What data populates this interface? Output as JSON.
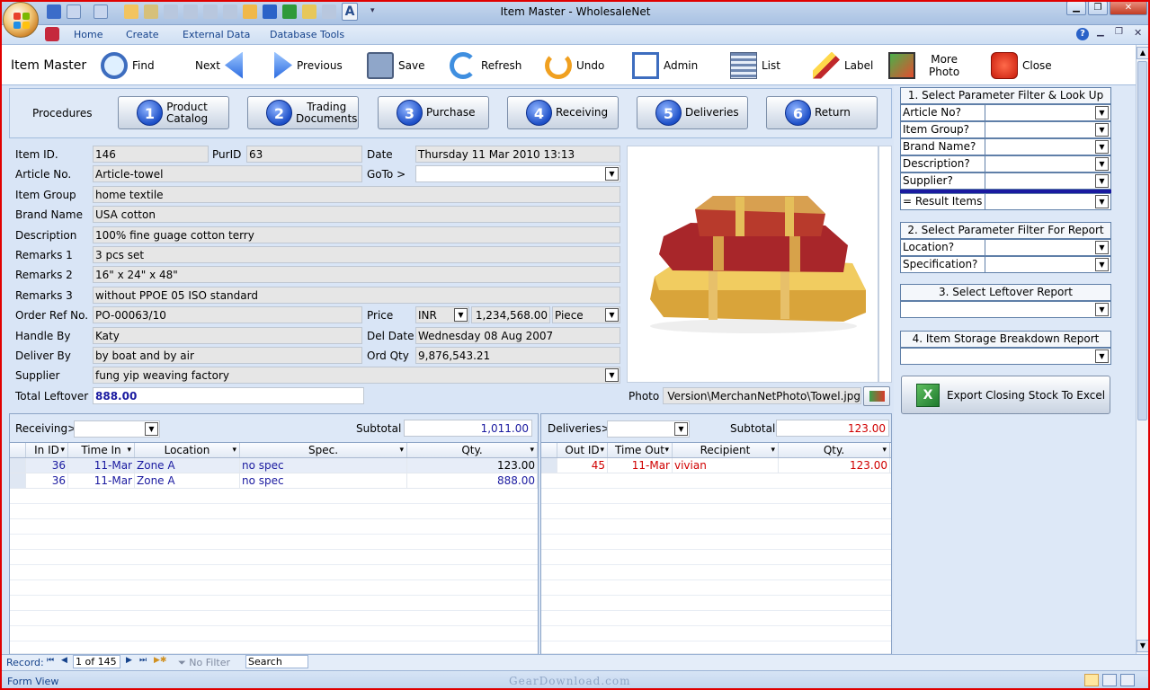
{
  "window": {
    "title": "Item Master - WholesaleNet"
  },
  "menu": {
    "items": [
      "Home",
      "Create",
      "External Data",
      "Database Tools"
    ]
  },
  "toolbar": {
    "form_title": "Item Master",
    "find": "Find",
    "next": "Next",
    "previous": "Previous",
    "save": "Save",
    "refresh": "Refresh",
    "undo": "Undo",
    "admin": "Admin",
    "list": "List",
    "label": "Label",
    "more_photo_1": "More",
    "more_photo_2": "Photo",
    "close": "Close"
  },
  "procedures": {
    "label": "Procedures",
    "buttons": [
      {
        "num": "1",
        "line1": "Product",
        "line2": "Catalog"
      },
      {
        "num": "2",
        "line1": "Trading",
        "line2": "Documents"
      },
      {
        "num": "3",
        "line1": "Purchase",
        "line2": ""
      },
      {
        "num": "4",
        "line1": "Receiving",
        "line2": ""
      },
      {
        "num": "5",
        "line1": "Deliveries",
        "line2": ""
      },
      {
        "num": "6",
        "line1": "Return",
        "line2": ""
      }
    ]
  },
  "item": {
    "item_id_label": "Item ID.",
    "item_id": "146",
    "purid_label": "PurID",
    "purid": "63",
    "date_label": "Date",
    "date": "Thursday 11 Mar 2010 13:13",
    "article_label": "Article No.",
    "article": "Article-towel",
    "goto_label": "GoTo >",
    "goto": "",
    "group_label": "Item Group",
    "group": "home textile",
    "brand_label": "Brand Name",
    "brand": "USA cotton",
    "desc_label": "Description",
    "desc": "100% fine guage cotton terry",
    "rem1_label": "Remarks 1",
    "rem1": "3 pcs set",
    "rem2_label": "Remarks 2",
    "rem2": "16\" x 24\" x 48\"",
    "rem3_label": "Remarks 3",
    "rem3": "without PPOE 05 ISO standard",
    "order_label": "Order Ref No.",
    "order": "PO-00063/10",
    "price_label": "Price",
    "currency": "INR",
    "price": "1,234,568.00",
    "unit": "Piece",
    "handle_label": "Handle By",
    "handle": "Katy",
    "deldate_label": "Del Date",
    "deldate": "Wednesday 08 Aug 2007",
    "deliver_label": "Deliver By",
    "deliver": "by boat and by air",
    "ordqty_label": "Ord Qty",
    "ordqty": "9,876,543.21",
    "supplier_label": "Supplier",
    "supplier": "fung yip weaving factory",
    "leftover_label": "Total Leftover",
    "leftover": "888.00",
    "photo_label": "Photo",
    "photo_path": "g Version\\MerchanNetPhoto\\Towel.jpg"
  },
  "right": {
    "s1_title": "1. Select Parameter Filter & Look Up",
    "s1_rows": [
      "Article No?",
      "Item Group?",
      "Brand Name?",
      "Description?",
      "Supplier?"
    ],
    "s1_result": "= Result Items",
    "s2_title": "2. Select Parameter Filter For Report",
    "s2_rows": [
      "Location?",
      "Specification?"
    ],
    "s3_title": "3. Select Leftover Report",
    "s4_title": "4. Item Storage Breakdown Report",
    "export": "Export Closing Stock To Excel"
  },
  "receiving": {
    "label": "Receiving>",
    "subtotal_label": "Subtotal",
    "subtotal": "1,011.00",
    "columns": [
      "In ID",
      "Time In",
      "Location",
      "Spec.",
      "Qty."
    ],
    "rows": [
      [
        "36",
        "11-Mar",
        "Zone A",
        "no spec",
        "123.00"
      ],
      [
        "36",
        "11-Mar",
        "Zone A",
        "no spec",
        "888.00"
      ]
    ]
  },
  "deliveries": {
    "label": "Deliveries>",
    "subtotal_label": "Subtotal",
    "subtotal": "123.00",
    "columns": [
      "Out ID",
      "Time Out",
      "Recipient",
      "Qty."
    ],
    "rows": [
      [
        "45",
        "11-Mar",
        "vivian",
        "123.00"
      ]
    ]
  },
  "record": {
    "label": "Record:",
    "position": "1 of 145",
    "filter": "No Filter",
    "search": "Search"
  },
  "status": {
    "view": "Form View",
    "watermark": "GearDownload.com"
  },
  "colors": {
    "accent": "#15428b",
    "red": "#d00000",
    "blue_text": "#1a1aa0",
    "frame": "#e00000"
  }
}
